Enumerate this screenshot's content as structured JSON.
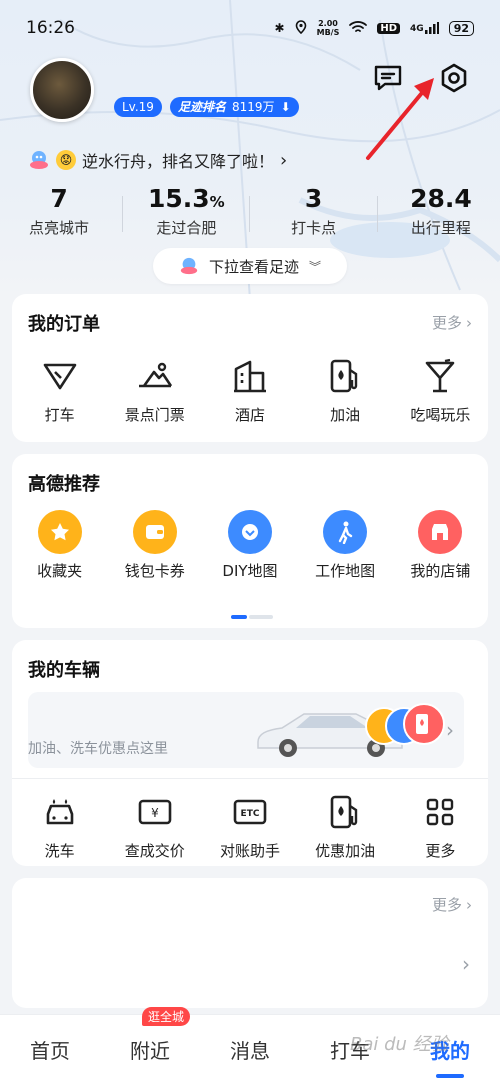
{
  "status_bar": {
    "time": "16:26",
    "speed_value": "2.00",
    "speed_unit": "MB/S",
    "hd": "HD",
    "signal": "4G",
    "battery": "92"
  },
  "profile": {
    "level": "Lv.19",
    "rank_label": "足迹排名",
    "rank_value": "8119万",
    "rank_message": "逆水行舟，排名又降了啦！",
    "pull_hint": "下拉查看足迹"
  },
  "stats": [
    {
      "value": "7",
      "unit": "",
      "label": "点亮城市"
    },
    {
      "value": "15.3",
      "unit": "%",
      "label": "走过合肥"
    },
    {
      "value": "3",
      "unit": "",
      "label": "打卡点"
    },
    {
      "value": "28.4",
      "unit": "",
      "label": "出行里程"
    }
  ],
  "orders": {
    "title": "我的订单",
    "more": "更多",
    "items": [
      {
        "label": "打车",
        "icon": "taxi-icon"
      },
      {
        "label": "景点门票",
        "icon": "scenic-icon"
      },
      {
        "label": "酒店",
        "icon": "hotel-icon"
      },
      {
        "label": "加油",
        "icon": "fuel-icon"
      },
      {
        "label": "吃喝玩乐",
        "icon": "drink-icon"
      }
    ]
  },
  "recommend": {
    "title": "高德推荐",
    "items": [
      {
        "label": "收藏夹",
        "icon": "star-icon",
        "color": "#ffb31a"
      },
      {
        "label": "钱包卡券",
        "icon": "wallet-icon",
        "color": "#ffb31a"
      },
      {
        "label": "DIY地图",
        "icon": "diy-map-icon",
        "color": "#3d8bff"
      },
      {
        "label": "工作地图",
        "icon": "walker-icon",
        "color": "#3d8bff"
      },
      {
        "label": "我的店铺",
        "icon": "shop-icon",
        "color": "#ff6161"
      }
    ]
  },
  "vehicle": {
    "title": "我的车辆",
    "banner_text": "加油、洗车优惠点这里",
    "items": [
      {
        "label": "洗车",
        "icon": "car-wash-icon"
      },
      {
        "label": "查成交价",
        "icon": "price-icon"
      },
      {
        "label": "对账助手",
        "icon": "etc-icon"
      },
      {
        "label": "优惠加油",
        "icon": "fuel-icon"
      },
      {
        "label": "更多",
        "icon": "grid-icon"
      }
    ]
  },
  "extra_card": {
    "more": "更多"
  },
  "nav": {
    "items": [
      "首页",
      "附近",
      "消息",
      "打车",
      "我的"
    ],
    "badge": "逛全城"
  },
  "watermark": "Bai du 经验",
  "colors": {
    "accent": "#1e6bff",
    "badge_red": "#ff4747",
    "annotation_red": "#e8242b"
  }
}
